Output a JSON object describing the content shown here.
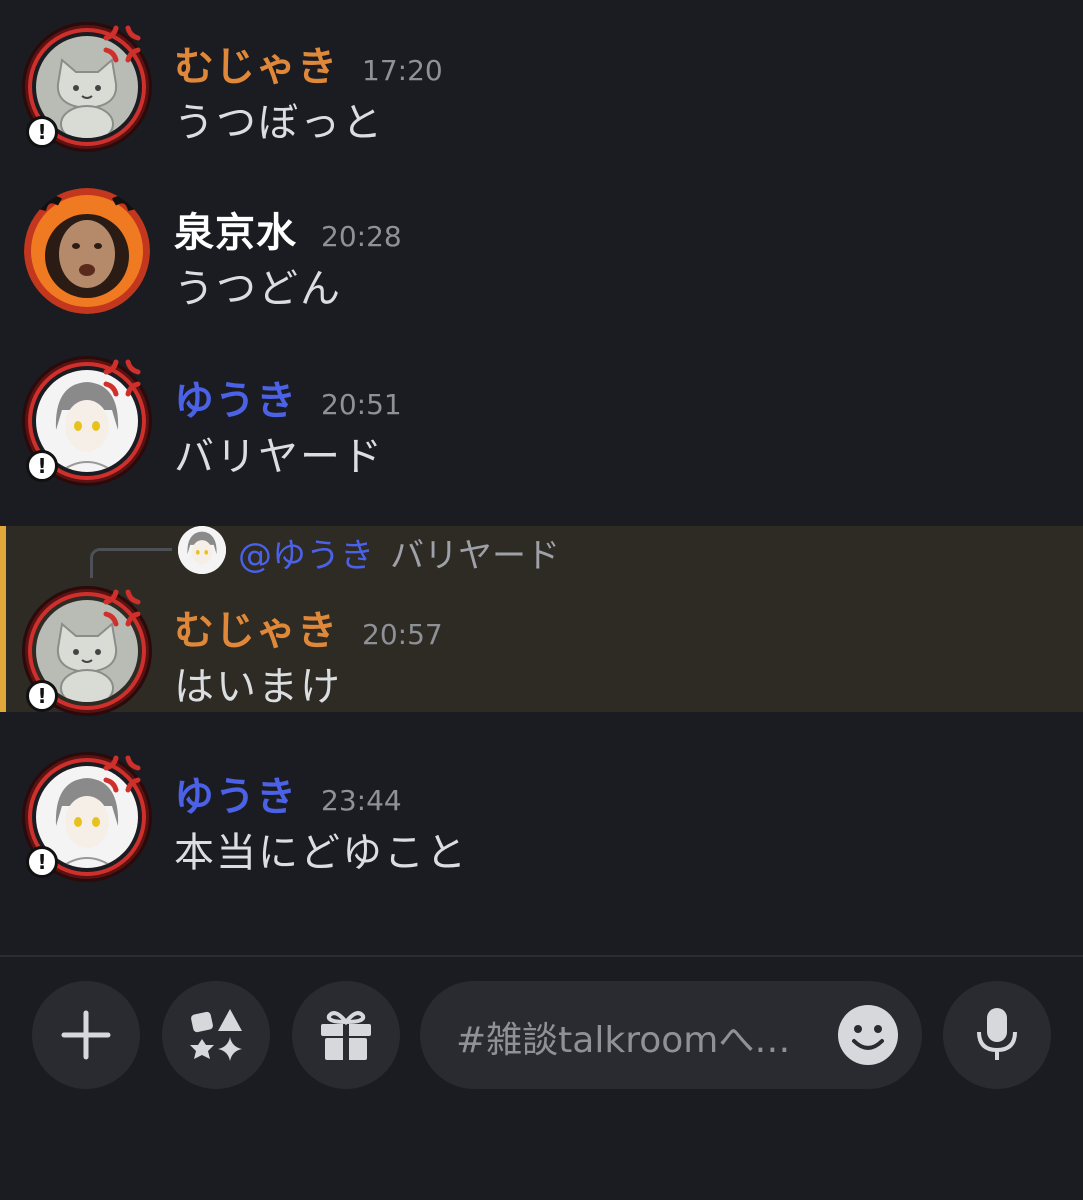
{
  "messages": [
    {
      "author": "むじゃき",
      "author_color": "#e0883a",
      "time": "17:20",
      "text": "うつぼっと",
      "avatar": "cat"
    },
    {
      "author": "泉京水",
      "author_color": "#ffffff",
      "time": "20:28",
      "text": "うつどん",
      "avatar": "fire"
    },
    {
      "author": "ゆうき",
      "author_color": "#4b62e6",
      "time": "20:51",
      "text": "バリヤード",
      "avatar": "anime"
    },
    {
      "author": "むじゃき",
      "author_color": "#e0883a",
      "time": "20:57",
      "text": "はいまけ",
      "avatar": "cat",
      "reply": {
        "mention": "@ゆうき",
        "text": "バリヤード"
      }
    },
    {
      "author": "ゆうき",
      "author_color": "#4b62e6",
      "time": "23:44",
      "text": "本当にどゆこと",
      "avatar": "anime"
    }
  ],
  "composer": {
    "placeholder": "#雑談talkroomへ…"
  },
  "colors": {
    "background": "#1b1c22",
    "highlight": "#2e2a24",
    "highlight_bar": "#e0a73a",
    "mention": "#4b62e6"
  }
}
